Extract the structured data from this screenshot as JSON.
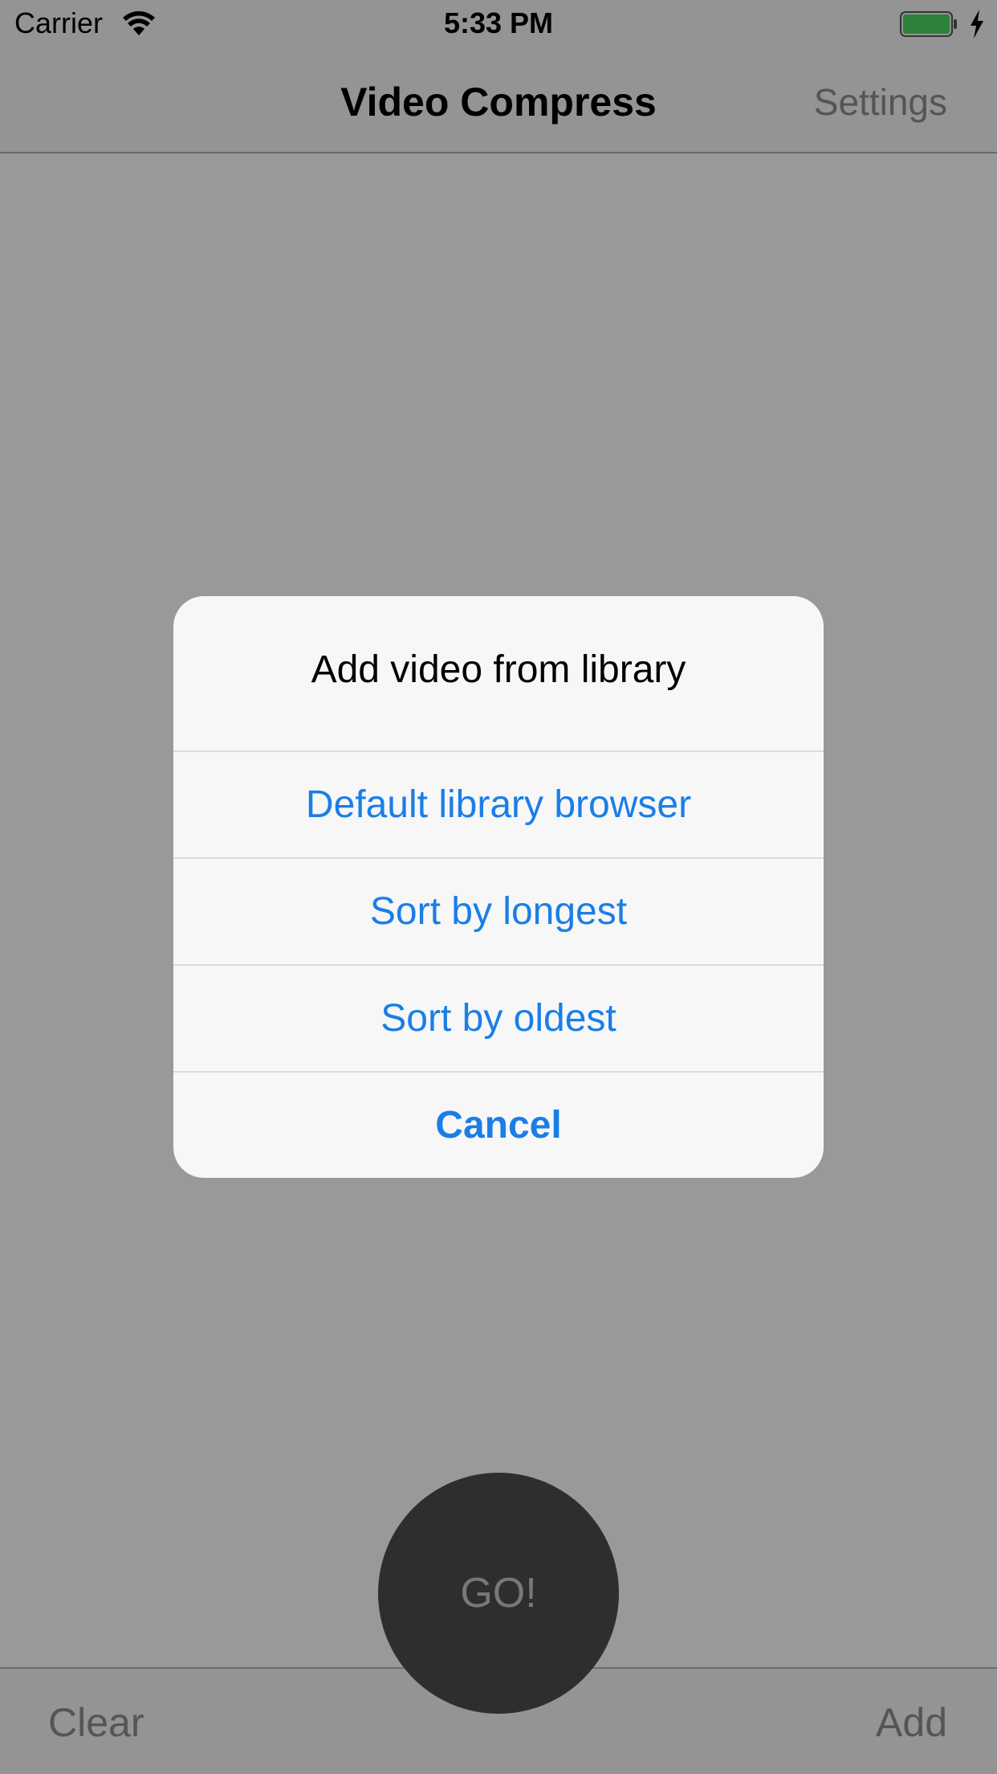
{
  "status_bar": {
    "carrier": "Carrier",
    "time": "5:33 PM",
    "wifi_icon": "wifi-icon",
    "battery_icon": "battery-icon",
    "charging_icon": "bolt-icon",
    "battery_color": "#4cd964"
  },
  "nav_bar": {
    "title": "Video Compress",
    "settings_label": "Settings"
  },
  "main": {
    "go_label": "GO!"
  },
  "toolbar": {
    "clear_label": "Clear",
    "add_label": "Add"
  },
  "alert": {
    "title": "Add video from library",
    "actions": [
      {
        "label": "Default library browser"
      },
      {
        "label": "Sort by longest"
      },
      {
        "label": "Sort by oldest"
      },
      {
        "label": "Cancel"
      }
    ]
  },
  "colors": {
    "accent": "#1a7ee8",
    "go_button": "#4e4e4e"
  }
}
